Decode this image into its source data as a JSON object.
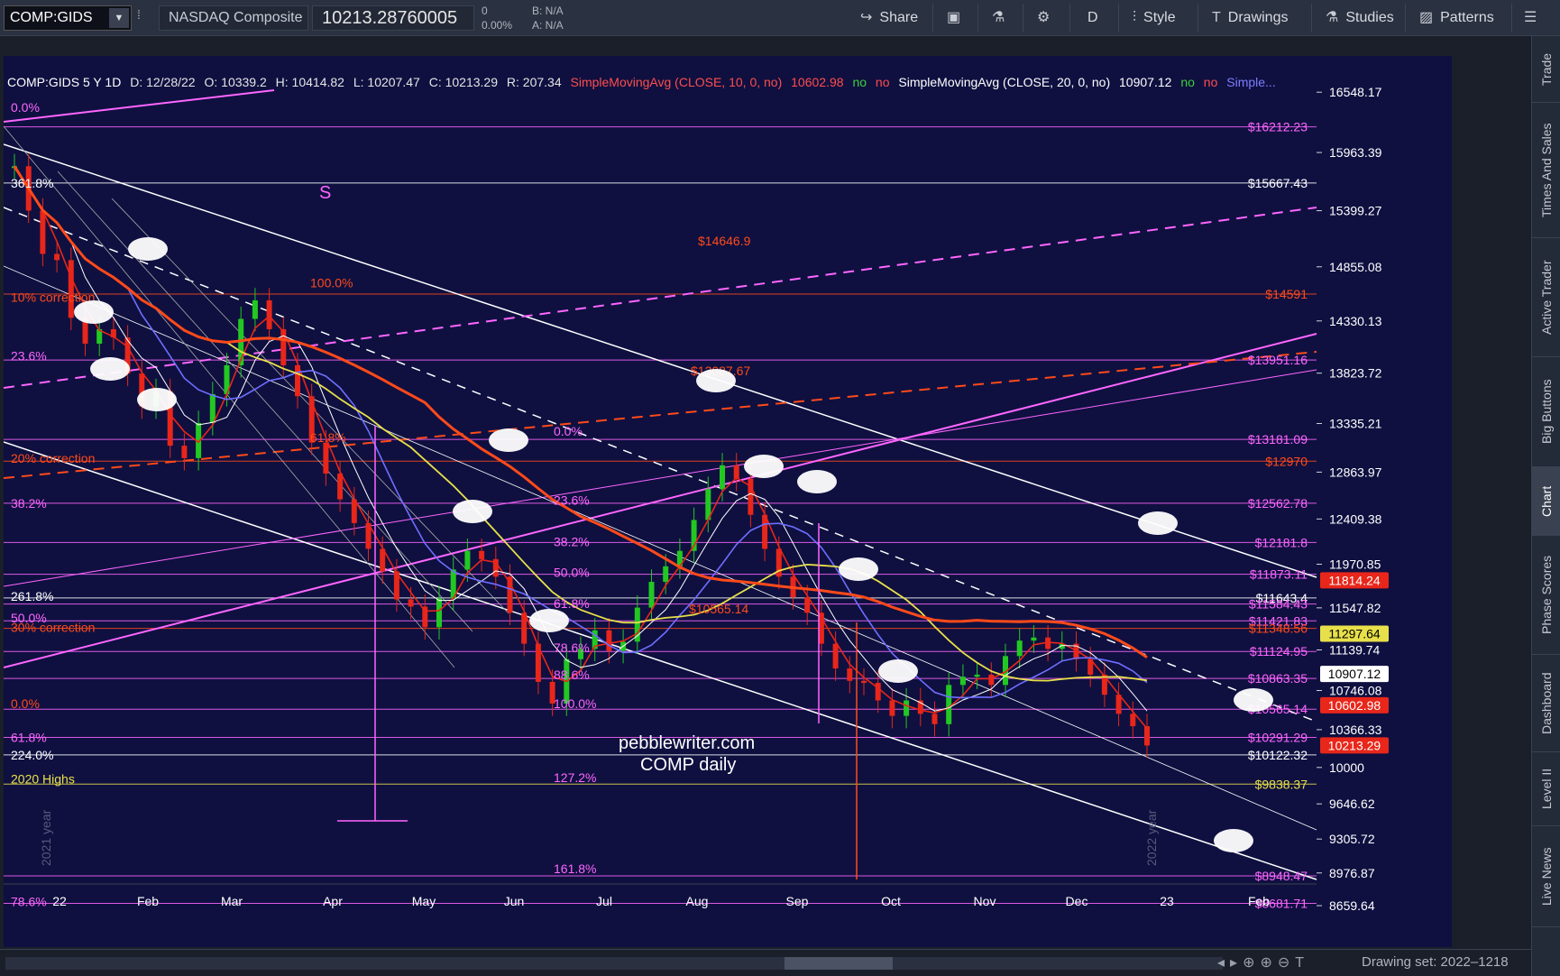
{
  "toolbar": {
    "symbol": "COMP:GIDS",
    "instrument_name": "NASDAQ Composite",
    "last_price": "10213.28760005",
    "change": "0",
    "change_pct": "0.00%",
    "bid": "B: N/A",
    "ask": "A: N/A",
    "share_label": "Share",
    "period_label": "D",
    "style_label": "Style",
    "drawings_label": "Drawings",
    "studies_label": "Studies",
    "patterns_label": "Patterns"
  },
  "study_header": {
    "symbol_period": "COMP:GIDS 5 Y 1D",
    "date": "D: 12/28/22",
    "open": "O: 10339.2",
    "high": "H: 10414.82",
    "low": "L: 10207.47",
    "close": "C: 10213.29",
    "range": "R: 207.34",
    "sma1_name": "SimpleMovingAvg (CLOSE, 10, 0, no)",
    "sma1_value": "10602.98",
    "no1": "no",
    "no2": "no",
    "sma2_name": "SimpleMovingAvg (CLOSE, 20, 0, no)",
    "sma2_value": "10907.12",
    "no3": "no",
    "no4": "no",
    "sma3_name": "Simple..."
  },
  "side_tabs": [
    "Trade",
    "Times And Sales",
    "Active Trader",
    "Big Buttons",
    "Chart",
    "Phase Scores",
    "Dashboard",
    "Level II",
    "Live News"
  ],
  "bottom": {
    "drawing_set": "Drawing set: 2022–1218"
  },
  "colors": {
    "bg": "#0f1040",
    "magenta": "#ff66ff",
    "orange": "#ff4a1a",
    "white": "#ffffff",
    "yellow": "#e8e04a",
    "blue_sma": "#6e6eff"
  },
  "chart_data": {
    "type": "candlestick",
    "ylim": [
      8450,
      16900
    ],
    "y_ticks": [
      16548.17,
      15963.39,
      15399.27,
      14855.08,
      14330.13,
      13823.72,
      13335.21,
      12863.97,
      12409.38,
      11970.85,
      11547.82,
      11139.74,
      10746.08,
      10366.33,
      10000,
      9646.62,
      9305.72,
      8976.87,
      8659.64
    ],
    "x_labels": [
      "22",
      "Feb",
      "Mar",
      "Apr",
      "May",
      "Jun",
      "Jul",
      "Aug",
      "Sep",
      "Oct",
      "Nov",
      "Dec",
      "23",
      "Feb"
    ],
    "price_badges": [
      {
        "value": "11814.24",
        "color": "#e8261a",
        "y": 11814.24
      },
      {
        "value": "11297.64",
        "color": "#e8e04a",
        "y": 11297.64
      },
      {
        "value": "10907.12",
        "color": "#ffffff",
        "y": 10907.12
      },
      {
        "value": "10602.98",
        "color": "#e8261a",
        "y": 10602.98
      },
      {
        "value": "10213.29",
        "color": "#e8261a",
        "y": 10213.29
      }
    ],
    "level_labels": [
      {
        "text": "$16212.23",
        "y": 16212.23,
        "color": "#ff66ff"
      },
      {
        "text": "$15667.43",
        "y": 15667.43,
        "color": "#ffffff"
      },
      {
        "text": "$14591",
        "y": 14591,
        "color": "#ff4a1a"
      },
      {
        "text": "$13951.16",
        "y": 13951.16,
        "color": "#ff66ff"
      },
      {
        "text": "$13181.09",
        "y": 13181.09,
        "color": "#ff66ff"
      },
      {
        "text": "$12970",
        "y": 12970,
        "color": "#ff4a1a"
      },
      {
        "text": "$12562.78",
        "y": 12562.78,
        "color": "#ff66ff"
      },
      {
        "text": "$12181.8",
        "y": 12181.8,
        "color": "#ff66ff"
      },
      {
        "text": "$11873.11",
        "y": 11873.11,
        "color": "#ff66ff"
      },
      {
        "text": "$11643.4",
        "y": 11643.4,
        "color": "#ffffff"
      },
      {
        "text": "$11584.43",
        "y": 11584.43,
        "color": "#ff66ff"
      },
      {
        "text": "$11421.83",
        "y": 11421.83,
        "color": "#ff66ff"
      },
      {
        "text": "$11348.56",
        "y": 11348.56,
        "color": "#ff4a1a"
      },
      {
        "text": "$11124.95",
        "y": 11124.95,
        "color": "#ff66ff"
      },
      {
        "text": "$10863.35",
        "y": 10863.35,
        "color": "#ff66ff"
      },
      {
        "text": "$10565.14",
        "y": 10565.14,
        "color": "#ff66ff"
      },
      {
        "text": "$10291.29",
        "y": 10291.29,
        "color": "#ff66ff"
      },
      {
        "text": "$10122.32",
        "y": 10122.32,
        "color": "#ffffff"
      },
      {
        "text": "$9838.37",
        "y": 9838.37,
        "color": "#e8e04a"
      },
      {
        "text": "$8948.47",
        "y": 8948.47,
        "color": "#ff66ff"
      },
      {
        "text": "$8681.71",
        "y": 8681.71,
        "color": "#ff66ff"
      }
    ],
    "left_fib_labels": [
      {
        "text": "0.0%",
        "y": 16400,
        "color": "#ff66ff"
      },
      {
        "text": "361.8%",
        "y": 15667.43,
        "color": "#ffffff"
      },
      {
        "text": "10% correction",
        "y": 14560,
        "color": "#ff4a1a"
      },
      {
        "text": "23.6%",
        "y": 13990,
        "color": "#ff66ff"
      },
      {
        "text": "20% correction",
        "y": 13000,
        "color": "#ff4a1a"
      },
      {
        "text": "38.2%",
        "y": 12560,
        "color": "#ff66ff"
      },
      {
        "text": "261.8%",
        "y": 11660,
        "color": "#ffffff"
      },
      {
        "text": "50.0%",
        "y": 11450,
        "color": "#ff66ff"
      },
      {
        "text": "30% correction",
        "y": 11360,
        "color": "#ff4a1a"
      },
      {
        "text": "0.0%",
        "y": 10620,
        "color": "#ff4a1a"
      },
      {
        "text": "61.8%",
        "y": 10290,
        "color": "#ff66ff"
      },
      {
        "text": "224.0%",
        "y": 10122.32,
        "color": "#ffffff"
      },
      {
        "text": "2020 Highs",
        "y": 9890,
        "color": "#e8e04a"
      },
      {
        "text": "78.6%",
        "y": 8700,
        "color": "#ff66ff"
      }
    ],
    "mid_fib_labels": [
      {
        "text": "100.0%",
        "y": 14700,
        "color": "#ff4a1a"
      },
      {
        "text": "61.8%",
        "y": 13200,
        "color": "#ff4a1a"
      },
      {
        "text": "0.0%",
        "y": 13260,
        "color": "#ff66ff"
      },
      {
        "text": "23.6%",
        "y": 12590,
        "color": "#ff66ff"
      },
      {
        "text": "38.2%",
        "y": 12190,
        "color": "#ff66ff"
      },
      {
        "text": "50.0%",
        "y": 11890,
        "color": "#ff66ff"
      },
      {
        "text": "61.8%",
        "y": 11590,
        "color": "#ff66ff"
      },
      {
        "text": "78.6%",
        "y": 11160,
        "color": "#ff66ff"
      },
      {
        "text": "88.6%",
        "y": 10900,
        "color": "#ff66ff"
      },
      {
        "text": "100.0%",
        "y": 10620,
        "color": "#ff66ff"
      },
      {
        "text": "127.2%",
        "y": 9900,
        "color": "#ff66ff"
      },
      {
        "text": "161.8%",
        "y": 9020,
        "color": "#ff66ff"
      }
    ],
    "annotations": [
      {
        "text": "$14646.9",
        "color": "#ff4a1a"
      },
      {
        "text": "$13087.67",
        "color": "#ff4a1a"
      },
      {
        "text": "$10565.14",
        "color": "#ff4a1a"
      },
      {
        "text": "S",
        "color": "#ff66ff"
      },
      {
        "text": "pebblewriter.com",
        "color": "#ffffff"
      },
      {
        "text": "COMP daily",
        "color": "#ffffff"
      },
      {
        "text": "2021 year",
        "color": "#555a7a"
      },
      {
        "text": "2022 year",
        "color": "#555a7a"
      }
    ],
    "closes": [
      15830,
      15400,
      14980,
      14920,
      14360,
      14110,
      14250,
      14170,
      13820,
      13500,
      13650,
      13120,
      13000,
      13340,
      13620,
      13900,
      14350,
      14530,
      14250,
      13900,
      13600,
      13150,
      12850,
      12600,
      12370,
      12120,
      11900,
      11630,
      11560,
      11360,
      11640,
      11920,
      12100,
      12020,
      11850,
      11500,
      11200,
      10830,
      10620,
      11050,
      11150,
      11330,
      11130,
      11220,
      11550,
      11800,
      11950,
      12100,
      12400,
      12700,
      12930,
      12800,
      12450,
      12120,
      11850,
      11650,
      11500,
      11200,
      10960,
      10840,
      10820,
      10650,
      10500,
      10650,
      10520,
      10420,
      10800,
      10880,
      10900,
      10800,
      11080,
      11230,
      11260,
      11150,
      11200,
      11050,
      10900,
      10705,
      10520,
      10400,
      10213
    ]
  }
}
